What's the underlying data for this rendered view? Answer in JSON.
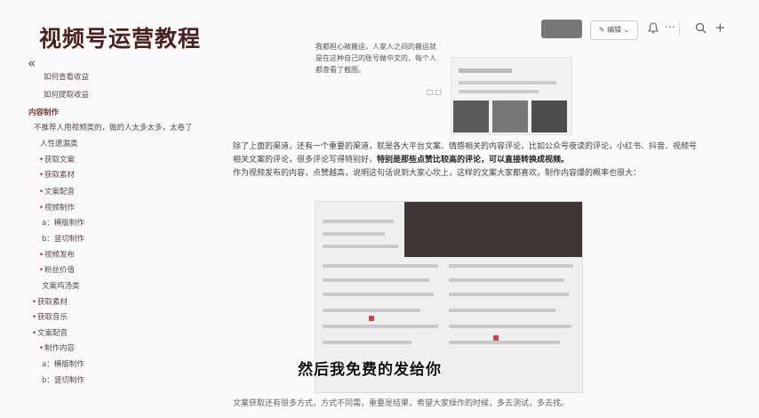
{
  "brand": {
    "title": "视频号运营教程"
  },
  "sidebar": {
    "collapse_icon": "«",
    "items": [
      {
        "label": "如何查看收益",
        "kind": "child"
      },
      {
        "label": "如何提取收益",
        "kind": "child"
      },
      {
        "label": "内容制作",
        "kind": "section"
      },
      {
        "label": "不推荐人用视频类的，做的人太多太多，太卷了",
        "kind": "child"
      },
      {
        "label": "人性遗漏类",
        "kind": "child"
      },
      {
        "label": "获取文案",
        "kind": "bullet"
      },
      {
        "label": "获取素材",
        "kind": "bullet"
      },
      {
        "label": "文案配音",
        "kind": "bullet"
      },
      {
        "label": "视频制作",
        "kind": "bullet"
      },
      {
        "label": "a：横版制作",
        "kind": "child"
      },
      {
        "label": "b：竖切制作",
        "kind": "child"
      },
      {
        "label": "视频发布",
        "kind": "bullet"
      },
      {
        "label": "粉丝价值",
        "kind": "bullet"
      },
      {
        "label": "文案鸡汤类",
        "kind": "child"
      },
      {
        "label": "获取素材",
        "kind": "bullet"
      },
      {
        "label": "获取音乐",
        "kind": "bullet"
      },
      {
        "label": "文案配音",
        "kind": "bullet"
      },
      {
        "label": "制作内容",
        "kind": "bullet"
      },
      {
        "label": "a：横版制作",
        "kind": "child"
      },
      {
        "label": "b：竖切制作",
        "kind": "child"
      }
    ]
  },
  "toolbar": {
    "edit_label": "✎ 编辑 ⌄",
    "bell_icon": "bell-icon",
    "more_icon": "more-icon",
    "search_icon": "search-icon",
    "add_icon": "add-icon"
  },
  "content": {
    "snippet": "我都担心被搬运，人家人之间的搬运就是在这种自己的账号做中文的，每个人都查看了截图。",
    "paragraph_before": "除了上面的渠道，还有一个重要的渠道，就是各大平台文案、情感相关的内容评论，比如公众号夜读的评论，小红书、抖音、视频号相关文案的评论，很多评论写得特别好，",
    "paragraph_highlight": "特别是那些点赞比较高的评论，可以直接转换成视频。",
    "paragraph_after": "作为视频发布的内容，点赞越高，说明这句话说到大家心坎上，这样的文案大家都喜欢，制作内容爆的概率也很大：",
    "subtitle": "然后我免费的发给你",
    "bottom_text": "文案获取还有很多方式，方式不同需，重要是结果，希望大家操作的时候，多去测试，多去找。"
  }
}
